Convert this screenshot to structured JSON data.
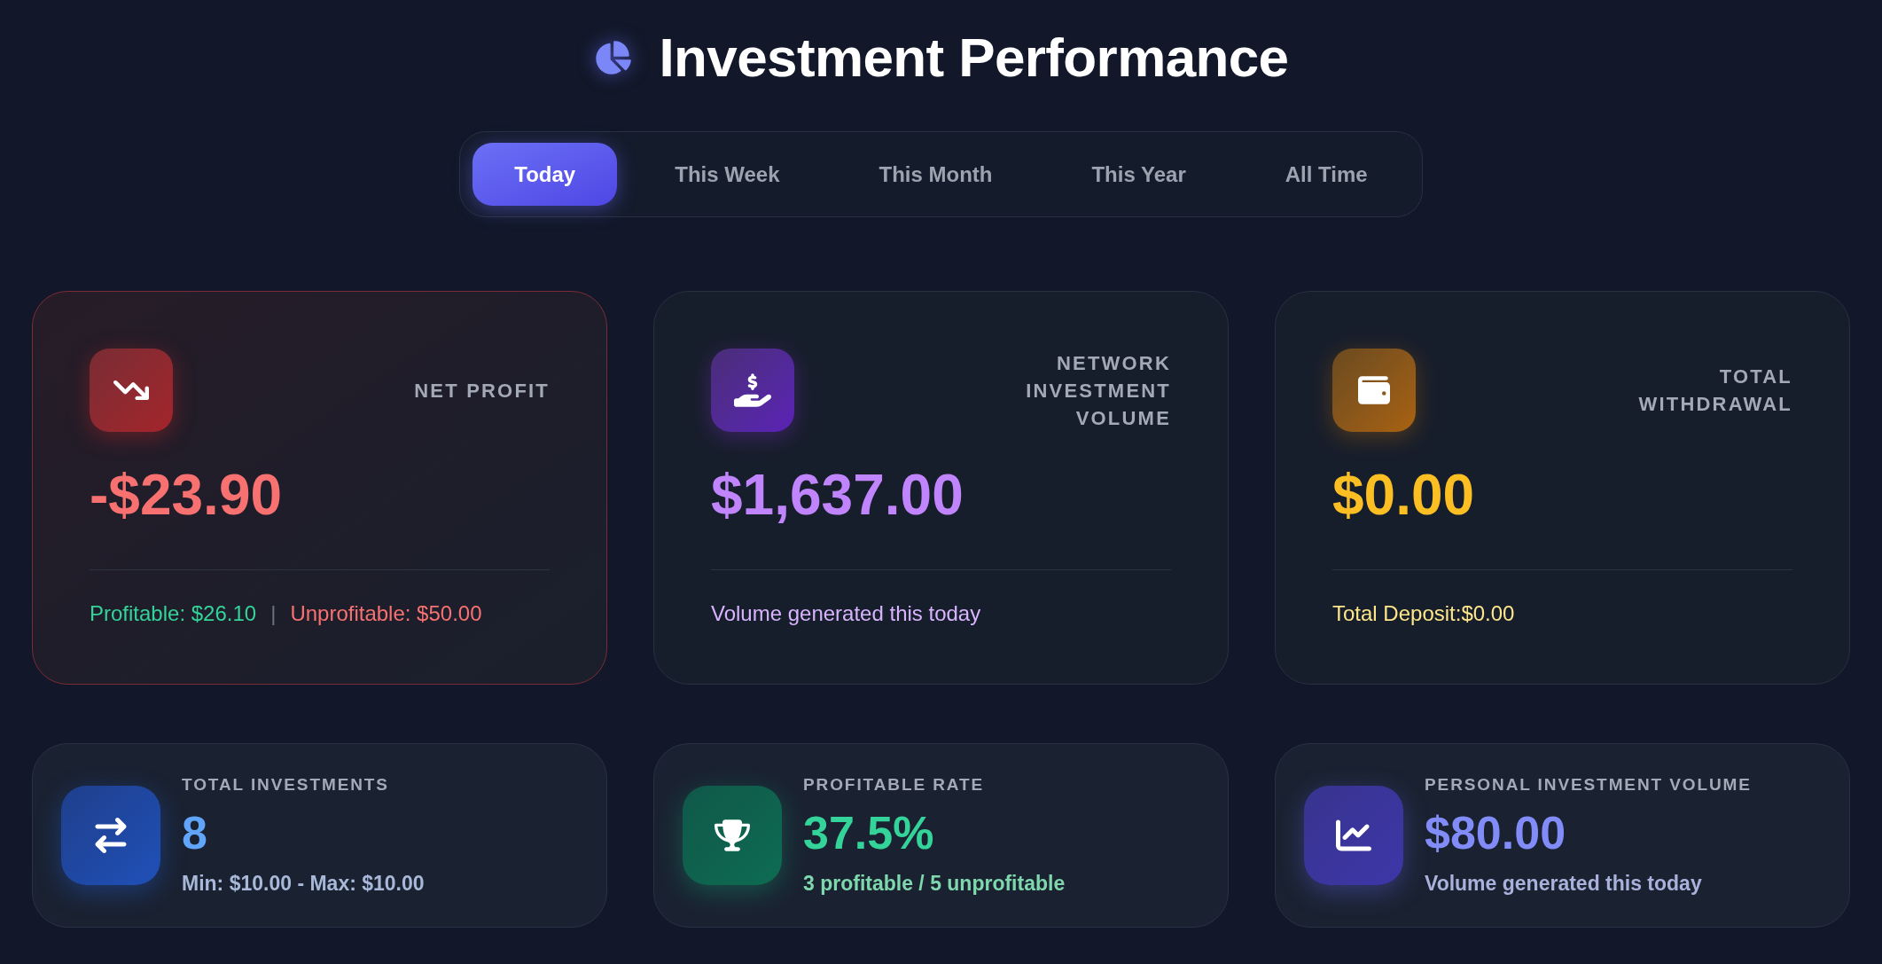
{
  "header": {
    "title": "Investment Performance"
  },
  "period_tabs": [
    {
      "label": "Today",
      "selected": true
    },
    {
      "label": "This Week",
      "selected": false
    },
    {
      "label": "This Month",
      "selected": false
    },
    {
      "label": "This Year",
      "selected": false
    },
    {
      "label": "All Time",
      "selected": false
    }
  ],
  "summary_cards": [
    {
      "kind": "loss",
      "label": "NET PROFIT",
      "value": "-$23.90",
      "footer": [
        {
          "kind": "gain",
          "text": "Profitable: $26.10"
        },
        {
          "kind": "divider",
          "text": "|"
        },
        {
          "kind": "loss",
          "text": "Unprofitable: $50.00"
        }
      ]
    },
    {
      "kind": "network",
      "label": "NETWORK INVESTMENT VOLUME",
      "value": "$1,637.00",
      "footer": [
        {
          "kind": "note",
          "text": "Volume generated this today"
        }
      ]
    },
    {
      "kind": "withdrawal",
      "label": "TOTAL WITHDRAWAL",
      "value": "$0.00",
      "footer": [
        {
          "kind": "note",
          "text": "Total Deposit:$0.00"
        }
      ]
    }
  ],
  "stat_cards": [
    {
      "kind": "count",
      "label": "TOTAL INVESTMENTS",
      "value": "8",
      "detail": "Min: $10.00 - Max: $10.00"
    },
    {
      "kind": "rate",
      "label": "PROFITABLE RATE",
      "value": "37.5%",
      "detail": "3 profitable / 5 unprofitable"
    },
    {
      "kind": "volume",
      "label": "PERSONAL INVESTMENT VOLUME",
      "value": "$80.00",
      "detail": "Volume generated this today"
    }
  ]
}
